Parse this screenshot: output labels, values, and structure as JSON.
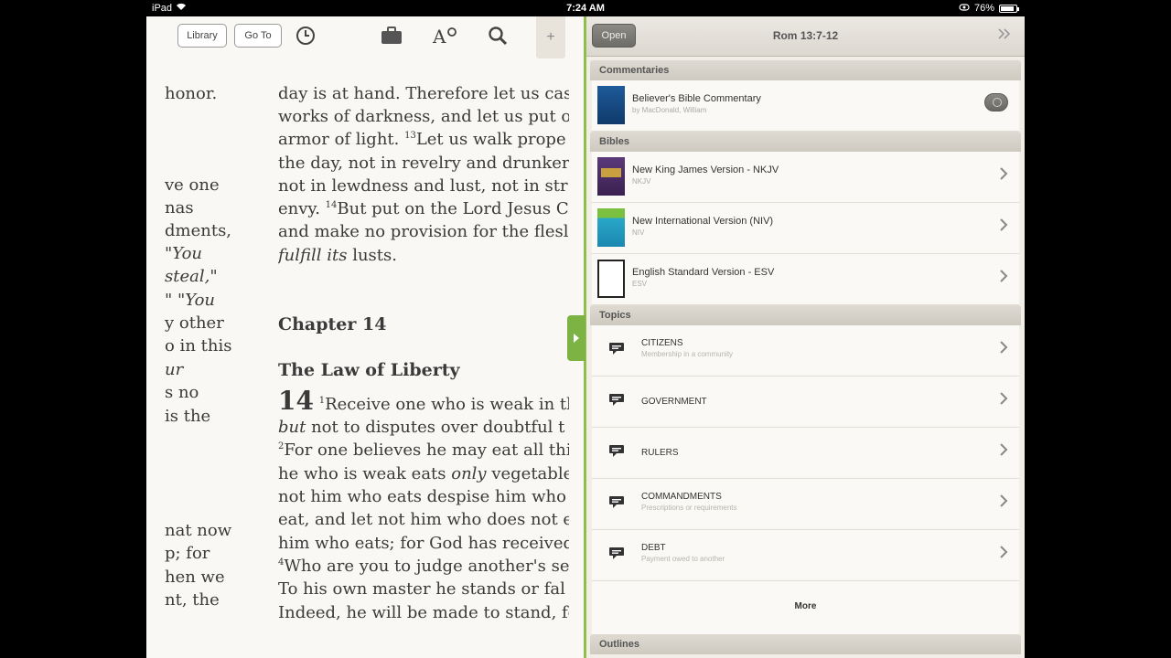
{
  "status_bar": {
    "device": "iPad",
    "time": "7:24 AM",
    "battery": "76%",
    "battery_level": 0.76
  },
  "reader": {
    "toolbar": {
      "library_label": "Library",
      "goto_label": "Go To",
      "bookmark_symbol": "+"
    },
    "left_column": [
      "honor.",
      "ve one",
      "nas",
      "dments,",
      "\"You",
      "steal,\"",
      "\" \"You",
      "y other",
      "o in this",
      "ur",
      "s no",
      "is the",
      "nat now",
      "p; for",
      "hen we",
      "nt, the"
    ],
    "main": {
      "l1": "day is at hand. Therefore let us cas",
      "l2": "works of darkness, and let us put o",
      "l3a": "armor of light. ",
      "l3n": "13",
      "l3b": "Let us walk prope",
      "l4": "the day, not in revelry and drunker",
      "l5": "not in lewdness and lust, not in str",
      "l6a": "envy. ",
      "l6n": "14",
      "l6b": "But put on the Lord Jesus C",
      "l7": "and make no provision for the flesl",
      "l8a": "fulfill its",
      "l8b": " lusts.",
      "chapter": "Chapter 14",
      "section": "The Law of Liberty",
      "v1_big": "14",
      "v1_n": "1",
      "v1_text": "Receive one who is weak in tl",
      "l11a": "but",
      "l11b": " not to disputes over doubtful t",
      "l12n": "2",
      "l12": "For one believes he may eat all thi",
      "l13a": "he who is weak eats ",
      "l13b": "only",
      "l13c": " vegetable",
      "l14": "not him who eats despise him who",
      "l15": "eat, and let not him who does not e",
      "l16": "him who eats; for God has received",
      "l17n": "4",
      "l17": "Who are you to judge another's se",
      "l18": "To his own master he stands or fal",
      "l19": "Indeed, he will be made to stand, fo"
    }
  },
  "panel": {
    "open_label": "Open",
    "title": "Rom 13:7-12",
    "commentaries_header": "Commentaries",
    "commentary": {
      "title": "Believer's Bible Commentary",
      "sub": "by MacDonald, William"
    },
    "bibles_header": "Bibles",
    "bibles": [
      {
        "title": "New King James Version - NKJV",
        "sub": "NKJV"
      },
      {
        "title": "New International Version (NIV)",
        "sub": "NIV"
      },
      {
        "title": "English Standard Version - ESV",
        "sub": "ESV"
      }
    ],
    "topics_header": "Topics",
    "topics": [
      {
        "title": "CITIZENS",
        "sub": "Membership in a community"
      },
      {
        "title": "GOVERNMENT",
        "sub": ""
      },
      {
        "title": "RULERS",
        "sub": ""
      },
      {
        "title": "COMMANDMENTS",
        "sub": "Prescriptions or requirements"
      },
      {
        "title": "DEBT",
        "sub": "Payment owed to another"
      }
    ],
    "more_label": "More",
    "outlines_header": "Outlines"
  }
}
